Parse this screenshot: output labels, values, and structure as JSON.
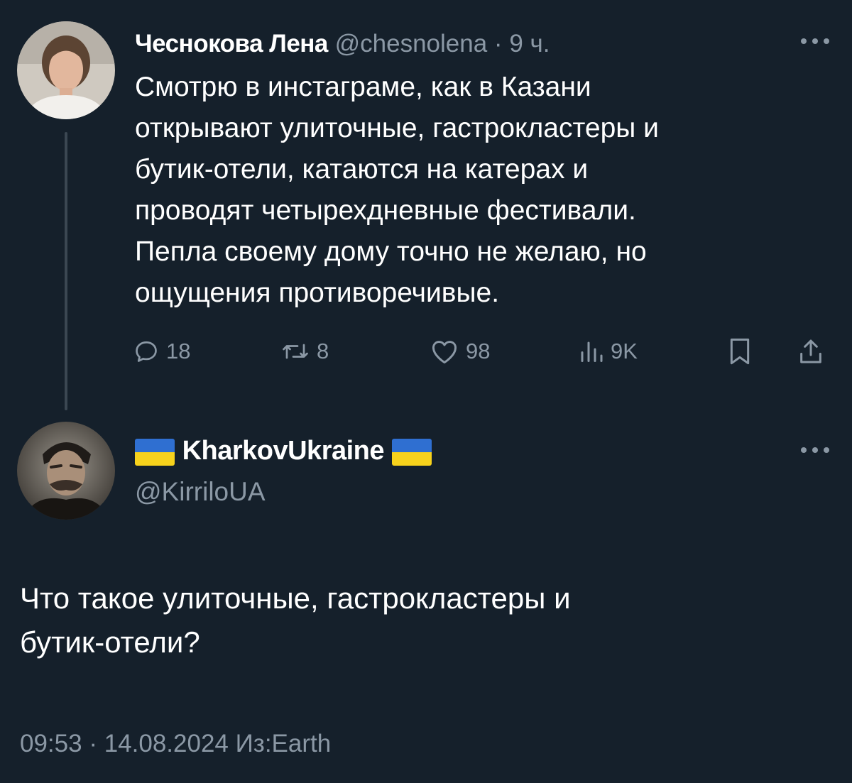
{
  "original_tweet": {
    "author_name": "Чеснокова Лена",
    "handle": "@chesnolena",
    "separator": " · ",
    "time_ago": "9 ч.",
    "text_lines": [
      "Смотрю в инстаграме, как в Казани",
      "открывают улиточные, гастрокластеры и",
      "бутик-отели, катаются на катерах и",
      "проводят четырехдневные фестивали.",
      "Пепла своему дому точно не желаю, но",
      "ощущения противоречивые."
    ],
    "stats": {
      "replies": "18",
      "retweets": "8",
      "likes": "98",
      "views": "9K"
    },
    "icons": [
      "reply-icon",
      "retweet-icon",
      "like-icon",
      "views-icon",
      "bookmark-icon",
      "share-icon",
      "more-icon"
    ]
  },
  "reply_tweet": {
    "author_name": "KharkovUkraine",
    "handle": "@KirriloUA",
    "name_decoration": "ukraine-flag-emoji",
    "text_lines": [
      "Что такое улиточные, гастрокластеры и",
      "бутик-отели?"
    ],
    "time": "09:53",
    "separator": " · ",
    "date": "14.08.2024",
    "location": "Из:Earth"
  },
  "colors": {
    "background": "#15202b",
    "text_primary": "#ffffff",
    "text_muted": "#8b98a5",
    "thread_line": "#3b4752",
    "flag_blue": "#2f6fd1",
    "flag_yellow": "#f7d21c"
  }
}
